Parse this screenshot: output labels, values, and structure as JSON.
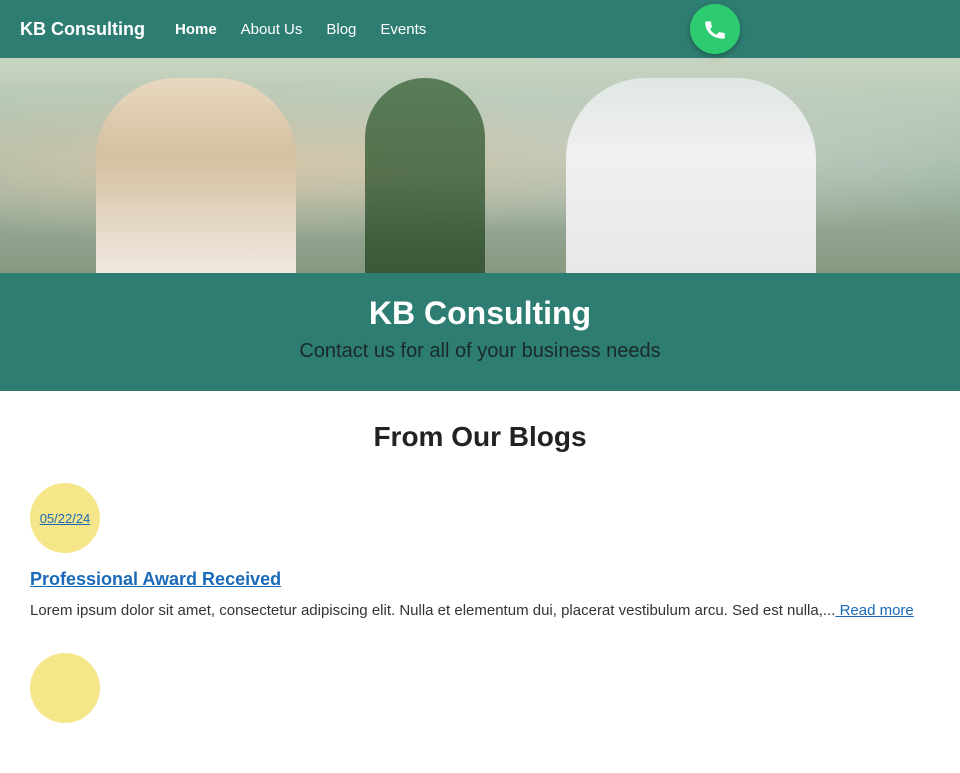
{
  "nav": {
    "brand": "KB Consulting",
    "links": [
      {
        "label": "Home",
        "active": true
      },
      {
        "label": "About Us",
        "active": false
      },
      {
        "label": "Blog",
        "active": false
      },
      {
        "label": "Events",
        "active": false
      }
    ]
  },
  "hero": {
    "title": "KB Consulting",
    "subtitle": "Contact us for all of your business needs"
  },
  "blog_section": {
    "title": "From Our Blogs",
    "posts": [
      {
        "date": "05/22/24",
        "post_title": "Professional Award Received",
        "excerpt": "Lorem ipsum dolor sit amet, consectetur adipiscing elit. Nulla et elementum dui, placerat vestibulum arcu. Sed est nulla,...",
        "read_more": "Read more"
      }
    ]
  }
}
